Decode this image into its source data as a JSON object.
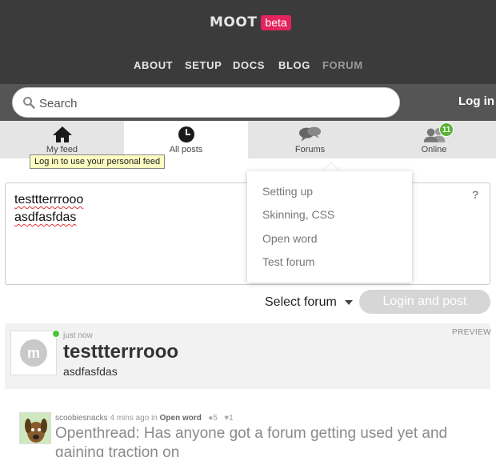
{
  "header": {
    "logo_text": "MOOT",
    "logo_badge": "beta",
    "nav": [
      "ABOUT",
      "SETUP",
      "DOCS",
      "BLOG",
      "FORUM"
    ]
  },
  "search": {
    "placeholder": "Search",
    "value": ""
  },
  "login_label": "Log in",
  "tabs": [
    {
      "label": "My feed",
      "icon": "home-icon"
    },
    {
      "label": "All posts",
      "icon": "clock-icon"
    },
    {
      "label": "Forums",
      "icon": "chat-bubbles-icon"
    },
    {
      "label": "Online",
      "icon": "users-icon",
      "badge": "11"
    }
  ],
  "tooltip": "Log in to use your personal feed",
  "editor": {
    "lines": [
      "testtterrrooo",
      "asdfasfdas"
    ],
    "help": "?"
  },
  "dropdown": {
    "options": [
      "Setting up",
      "Skinning, CSS",
      "Open word",
      "Test forum"
    ]
  },
  "select_forum_label": "Select forum",
  "post_button": "Login and post",
  "preview": {
    "time": "just now",
    "label": "PREVIEW",
    "title": "testtterrrooo",
    "body": "asdfasfdas",
    "avatar_letter": "m"
  },
  "feed_item": {
    "user": "scoobiesnacks",
    "time": "4 mins ago",
    "in_text": "in",
    "forum": "Open word",
    "replies": "5",
    "likes": "1",
    "title": "Openthread: Has anyone got a forum getting used yet and gaining traction on"
  },
  "colors": {
    "header_bg": "#3b3b3b",
    "search_row_bg": "#555555",
    "badge_green": "#59b336",
    "brand_pink": "#e2245d"
  }
}
